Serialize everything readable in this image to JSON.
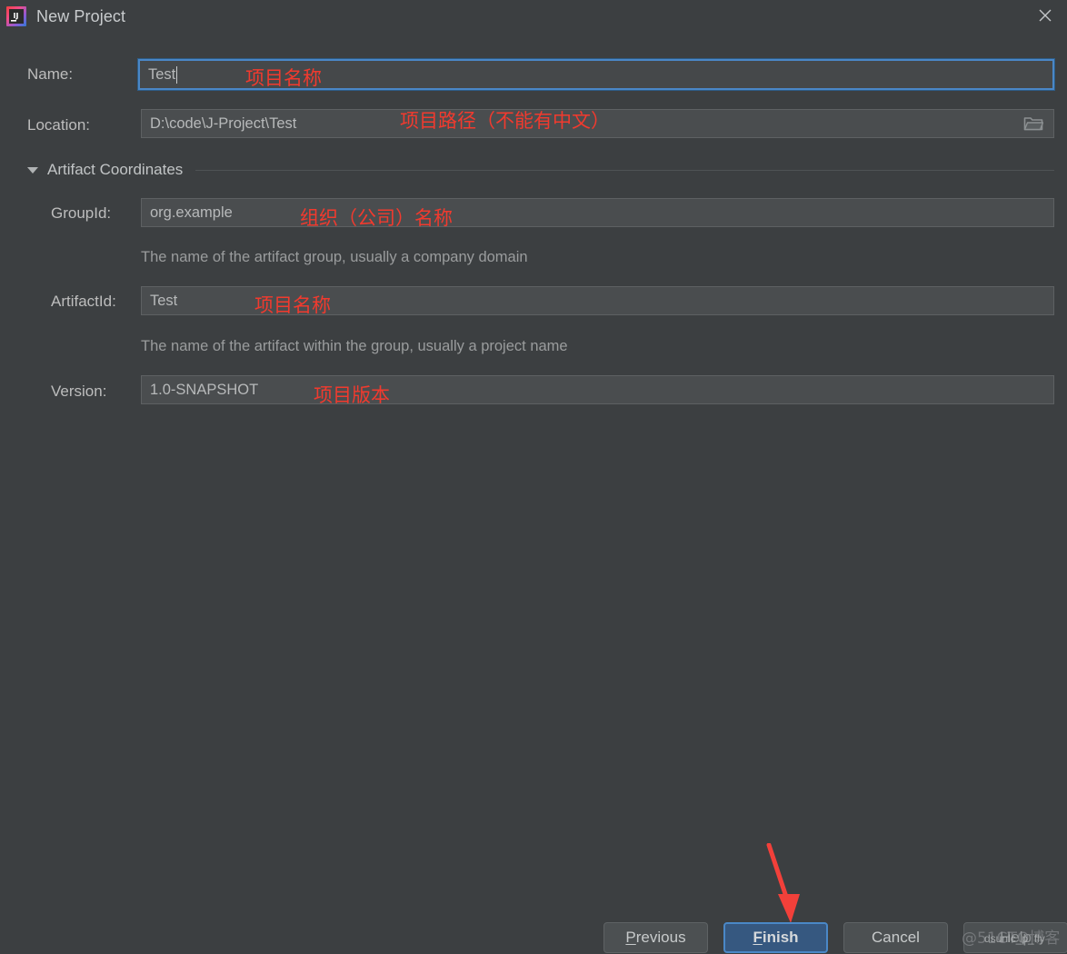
{
  "window": {
    "title": "New Project",
    "app_icon": "intellij-idea-icon",
    "close_icon": "close-icon"
  },
  "form": {
    "name": {
      "label": "Name:",
      "value": "Test",
      "placeholder": "",
      "annotation": "项目名称",
      "focused": true
    },
    "location": {
      "label": "Location:",
      "value": "D:\\code\\J-Project\\Test",
      "placeholder": "",
      "annotation": "项目路径（不能有中文）",
      "browse_icon": "folder-icon"
    },
    "section": {
      "title": "Artifact Coordinates",
      "expanded": true,
      "twisty_icon": "chevron-down-icon"
    },
    "group_id": {
      "label": "GroupId:",
      "value": "org.example",
      "placeholder": "",
      "annotation": "组织（公司）名称",
      "hint": "The name of the artifact group, usually a company domain"
    },
    "artifact_id": {
      "label": "ArtifactId:",
      "value": "Test",
      "placeholder": "",
      "annotation": "项目名称",
      "hint": "The name of the artifact within the group, usually a project name"
    },
    "version": {
      "label": "Version:",
      "value": "1.0-SNAPSHOT",
      "placeholder": "",
      "annotation": "项目版本"
    }
  },
  "footer": {
    "previous": "Previous",
    "previous_mnemonic": "P",
    "previous_rest": "revious",
    "finish": "Finish",
    "finish_mnemonic": "F",
    "finish_rest": "inish",
    "cancel": "Cancel",
    "help": "Help"
  },
  "overlay": {
    "arrow_icon": "red-arrow-icon",
    "watermark": "@51CTO博客",
    "watermark_handle": "dsunlc_p_fly"
  },
  "colors": {
    "background": "#3c3f41",
    "field_background": "#4a4d4f",
    "accent_blue": "#4a87c7",
    "primary_button": "#365880",
    "annotation_red": "#f23a2e",
    "text": "#bbbbbb",
    "hint_text": "#9a9c9d"
  }
}
